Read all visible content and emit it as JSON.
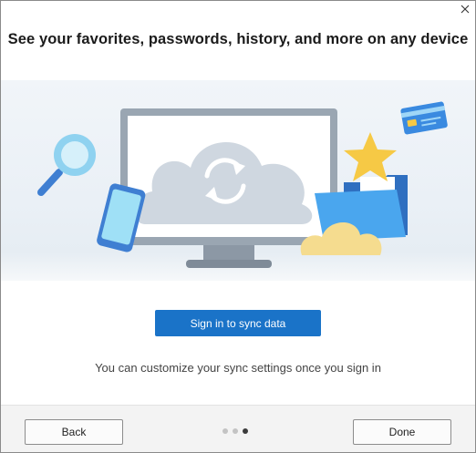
{
  "dialog": {
    "title": "See your favorites, passwords, history, and more on any device",
    "close_icon": "close-icon"
  },
  "illustration": {
    "elements": [
      "magnifier-icon",
      "phone-icon",
      "monitor-icon",
      "sync-icon",
      "cloud-icon",
      "star-icon",
      "folder-icon",
      "credit-card-icon"
    ],
    "colors": {
      "background": "#eaf0f6",
      "monitor": "#9aa6b2",
      "cloud": "#cfd7e0",
      "star": "#f6c945",
      "folder": "#3f8fdc",
      "card": "#3a8ae0",
      "magnifier": "#8fd2f0",
      "yellow_cloud": "#f5dc8f"
    }
  },
  "sign_in": {
    "label": "Sign in to sync data"
  },
  "hint": {
    "text": "You can customize your sync settings once you sign in"
  },
  "footer": {
    "back_label": "Back",
    "done_label": "Done",
    "page_indicator": {
      "total": 3,
      "current": 3
    }
  },
  "colors": {
    "accent": "#1a73c8",
    "footer_bg": "#f3f3f3"
  }
}
